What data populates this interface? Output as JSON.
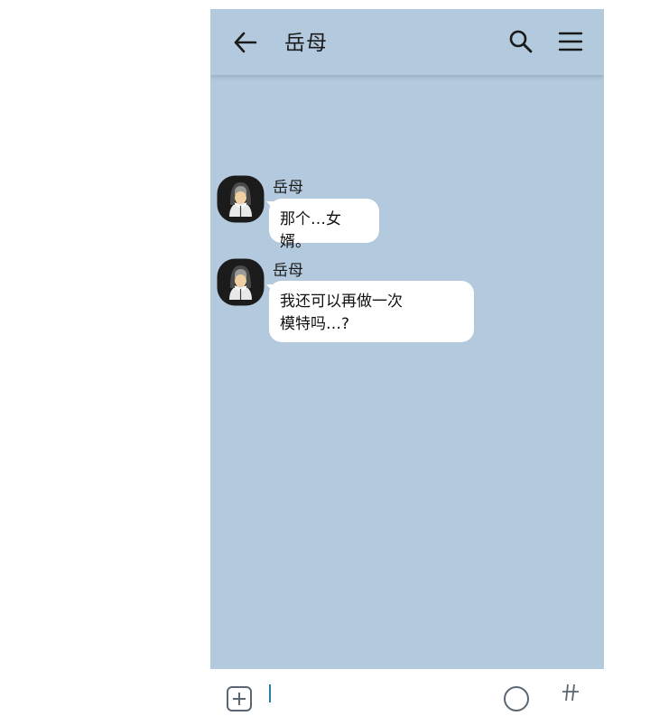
{
  "header": {
    "title": "岳母",
    "back_icon": "arrow-left-icon",
    "search_icon": "search-icon",
    "menu_icon": "hamburger-menu-icon"
  },
  "messages": [
    {
      "sender": "岳母",
      "text": "那个…女婿。",
      "avatar_icon": "nun-avatar-icon"
    },
    {
      "sender": "岳母",
      "text": "我还可以再做一次\n模特吗…?",
      "avatar_icon": "nun-avatar-icon"
    }
  ],
  "input_bar": {
    "plus_icon": "plus-icon",
    "emoji_icon": "emoji-icon",
    "hash_icon": "hash-icon"
  },
  "colors": {
    "background": "#b3c9dd",
    "bubble": "#ffffff",
    "text": "#1a1a1a"
  }
}
